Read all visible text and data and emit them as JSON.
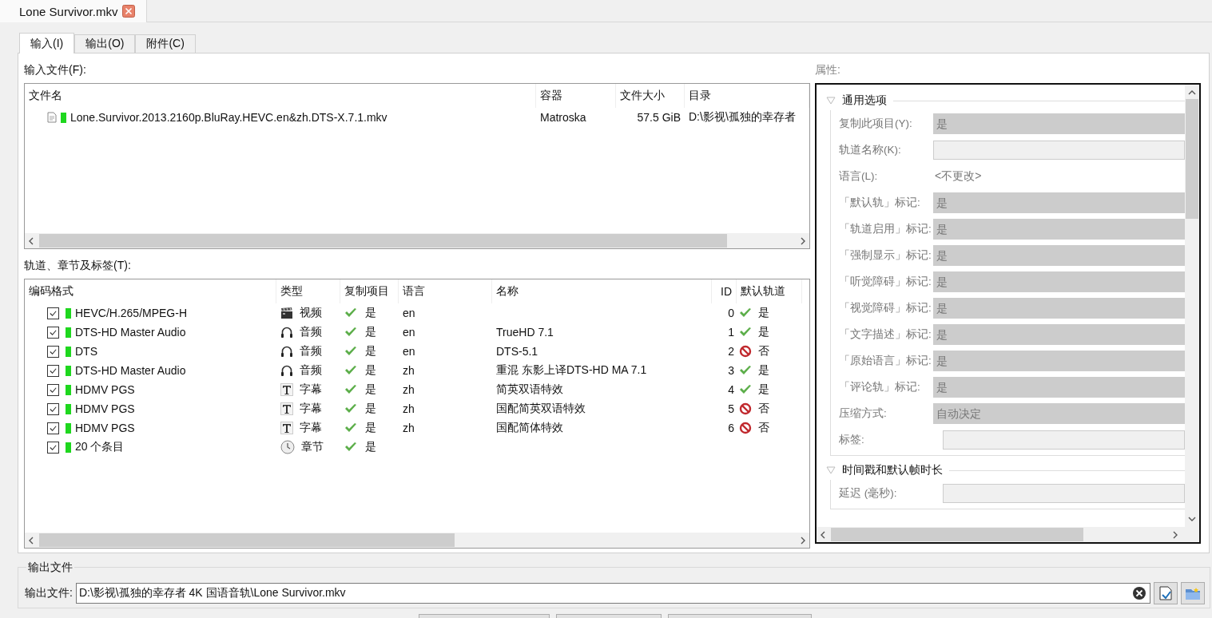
{
  "doc_tab": {
    "title": "Lone Survivor.mkv"
  },
  "tabs": [
    {
      "label": "输入(I)",
      "selected": true
    },
    {
      "label": "输出(O)",
      "selected": false
    },
    {
      "label": "附件(C)",
      "selected": false
    }
  ],
  "input_files": {
    "label": "输入文件(F):",
    "columns": [
      "文件名",
      "容器",
      "文件大小",
      "目录"
    ],
    "rows": [
      {
        "name": "Lone.Survivor.2013.2160p.BluRay.HEVC.en&zh.DTS-X.7.1.mkv",
        "container": "Matroska",
        "size": "57.5 GiB",
        "directory": "D:\\影视\\孤独的幸存者"
      }
    ]
  },
  "tracks": {
    "label": "轨道、章节及标签(T):",
    "columns": [
      "编码格式",
      "类型",
      "复制项目",
      "语言",
      "名称",
      "ID",
      "默认轨道"
    ],
    "rows": [
      {
        "checked": true,
        "codec": "HEVC/H.265/MPEG-H",
        "kind": "video",
        "type": "视频",
        "copy": "是",
        "copy_on": true,
        "language": "en",
        "name": "",
        "id": "0",
        "default": "是",
        "default_on": true
      },
      {
        "checked": true,
        "codec": "DTS-HD Master Audio",
        "kind": "audio",
        "type": "音频",
        "copy": "是",
        "copy_on": true,
        "language": "en",
        "name": "TrueHD 7.1",
        "id": "1",
        "default": "是",
        "default_on": true
      },
      {
        "checked": true,
        "codec": "DTS",
        "kind": "audio",
        "type": "音频",
        "copy": "是",
        "copy_on": true,
        "language": "en",
        "name": "DTS-5.1",
        "id": "2",
        "default": "否",
        "default_on": false
      },
      {
        "checked": true,
        "codec": "DTS-HD Master Audio",
        "kind": "audio",
        "type": "音频",
        "copy": "是",
        "copy_on": true,
        "language": "zh",
        "name": "重混 东影上译DTS-HD MA 7.1",
        "id": "3",
        "default": "是",
        "default_on": true
      },
      {
        "checked": true,
        "codec": "HDMV PGS",
        "kind": "subtitles",
        "type": "字幕",
        "copy": "是",
        "copy_on": true,
        "language": "zh",
        "name": "简英双语特效",
        "id": "4",
        "default": "是",
        "default_on": true
      },
      {
        "checked": true,
        "codec": "HDMV PGS",
        "kind": "subtitles",
        "type": "字幕",
        "copy": "是",
        "copy_on": true,
        "language": "zh",
        "name": "国配简英双语特效",
        "id": "5",
        "default": "否",
        "default_on": false
      },
      {
        "checked": true,
        "codec": "HDMV PGS",
        "kind": "subtitles",
        "type": "字幕",
        "copy": "是",
        "copy_on": true,
        "language": "zh",
        "name": "国配简体特效",
        "id": "6",
        "default": "否",
        "default_on": false
      },
      {
        "checked": true,
        "codec": "20 个条目",
        "kind": "chapters",
        "type": "章节",
        "copy": "是",
        "copy_on": true
      }
    ]
  },
  "properties": {
    "label": "属性:",
    "sections": [
      {
        "title": "通用选项",
        "expanded": true,
        "fields": [
          {
            "label": "复制此项目(Y):",
            "kind": "select",
            "value": "是"
          },
          {
            "label": "轨道名称(K):",
            "kind": "input"
          },
          {
            "label": "语言(L):",
            "kind": "text",
            "value": "<不更改>"
          },
          {
            "label": "「默认轨」标记:",
            "kind": "select",
            "value": "是"
          },
          {
            "label": "「轨道启用」标记:",
            "kind": "select",
            "value": "是"
          },
          {
            "label": "「强制显示」标记:",
            "kind": "select",
            "value": "是"
          },
          {
            "label": "「听觉障碍」标记:",
            "kind": "select",
            "value": "是"
          },
          {
            "label": "「视觉障碍」标记:",
            "kind": "select",
            "value": "是"
          },
          {
            "label": "「文字描述」标记:",
            "kind": "select",
            "value": "是"
          },
          {
            "label": "「原始语言」标记:",
            "kind": "select",
            "value": "是"
          },
          {
            "label": "「评论轨」标记:",
            "kind": "select",
            "value": "是"
          },
          {
            "label": "压缩方式:",
            "kind": "select",
            "value": "自动决定"
          },
          {
            "label": "标签:",
            "kind": "input"
          }
        ]
      },
      {
        "title": "时间戳和默认帧时长",
        "expanded": true,
        "fields": [
          {
            "label": "延迟 (毫秒):",
            "kind": "input"
          }
        ]
      }
    ]
  },
  "output": {
    "group_title": "输出文件",
    "label": "输出文件:",
    "value": "D:\\影视\\孤独的幸存者 4K 国语音轨\\Lone Survivor.mkv"
  }
}
